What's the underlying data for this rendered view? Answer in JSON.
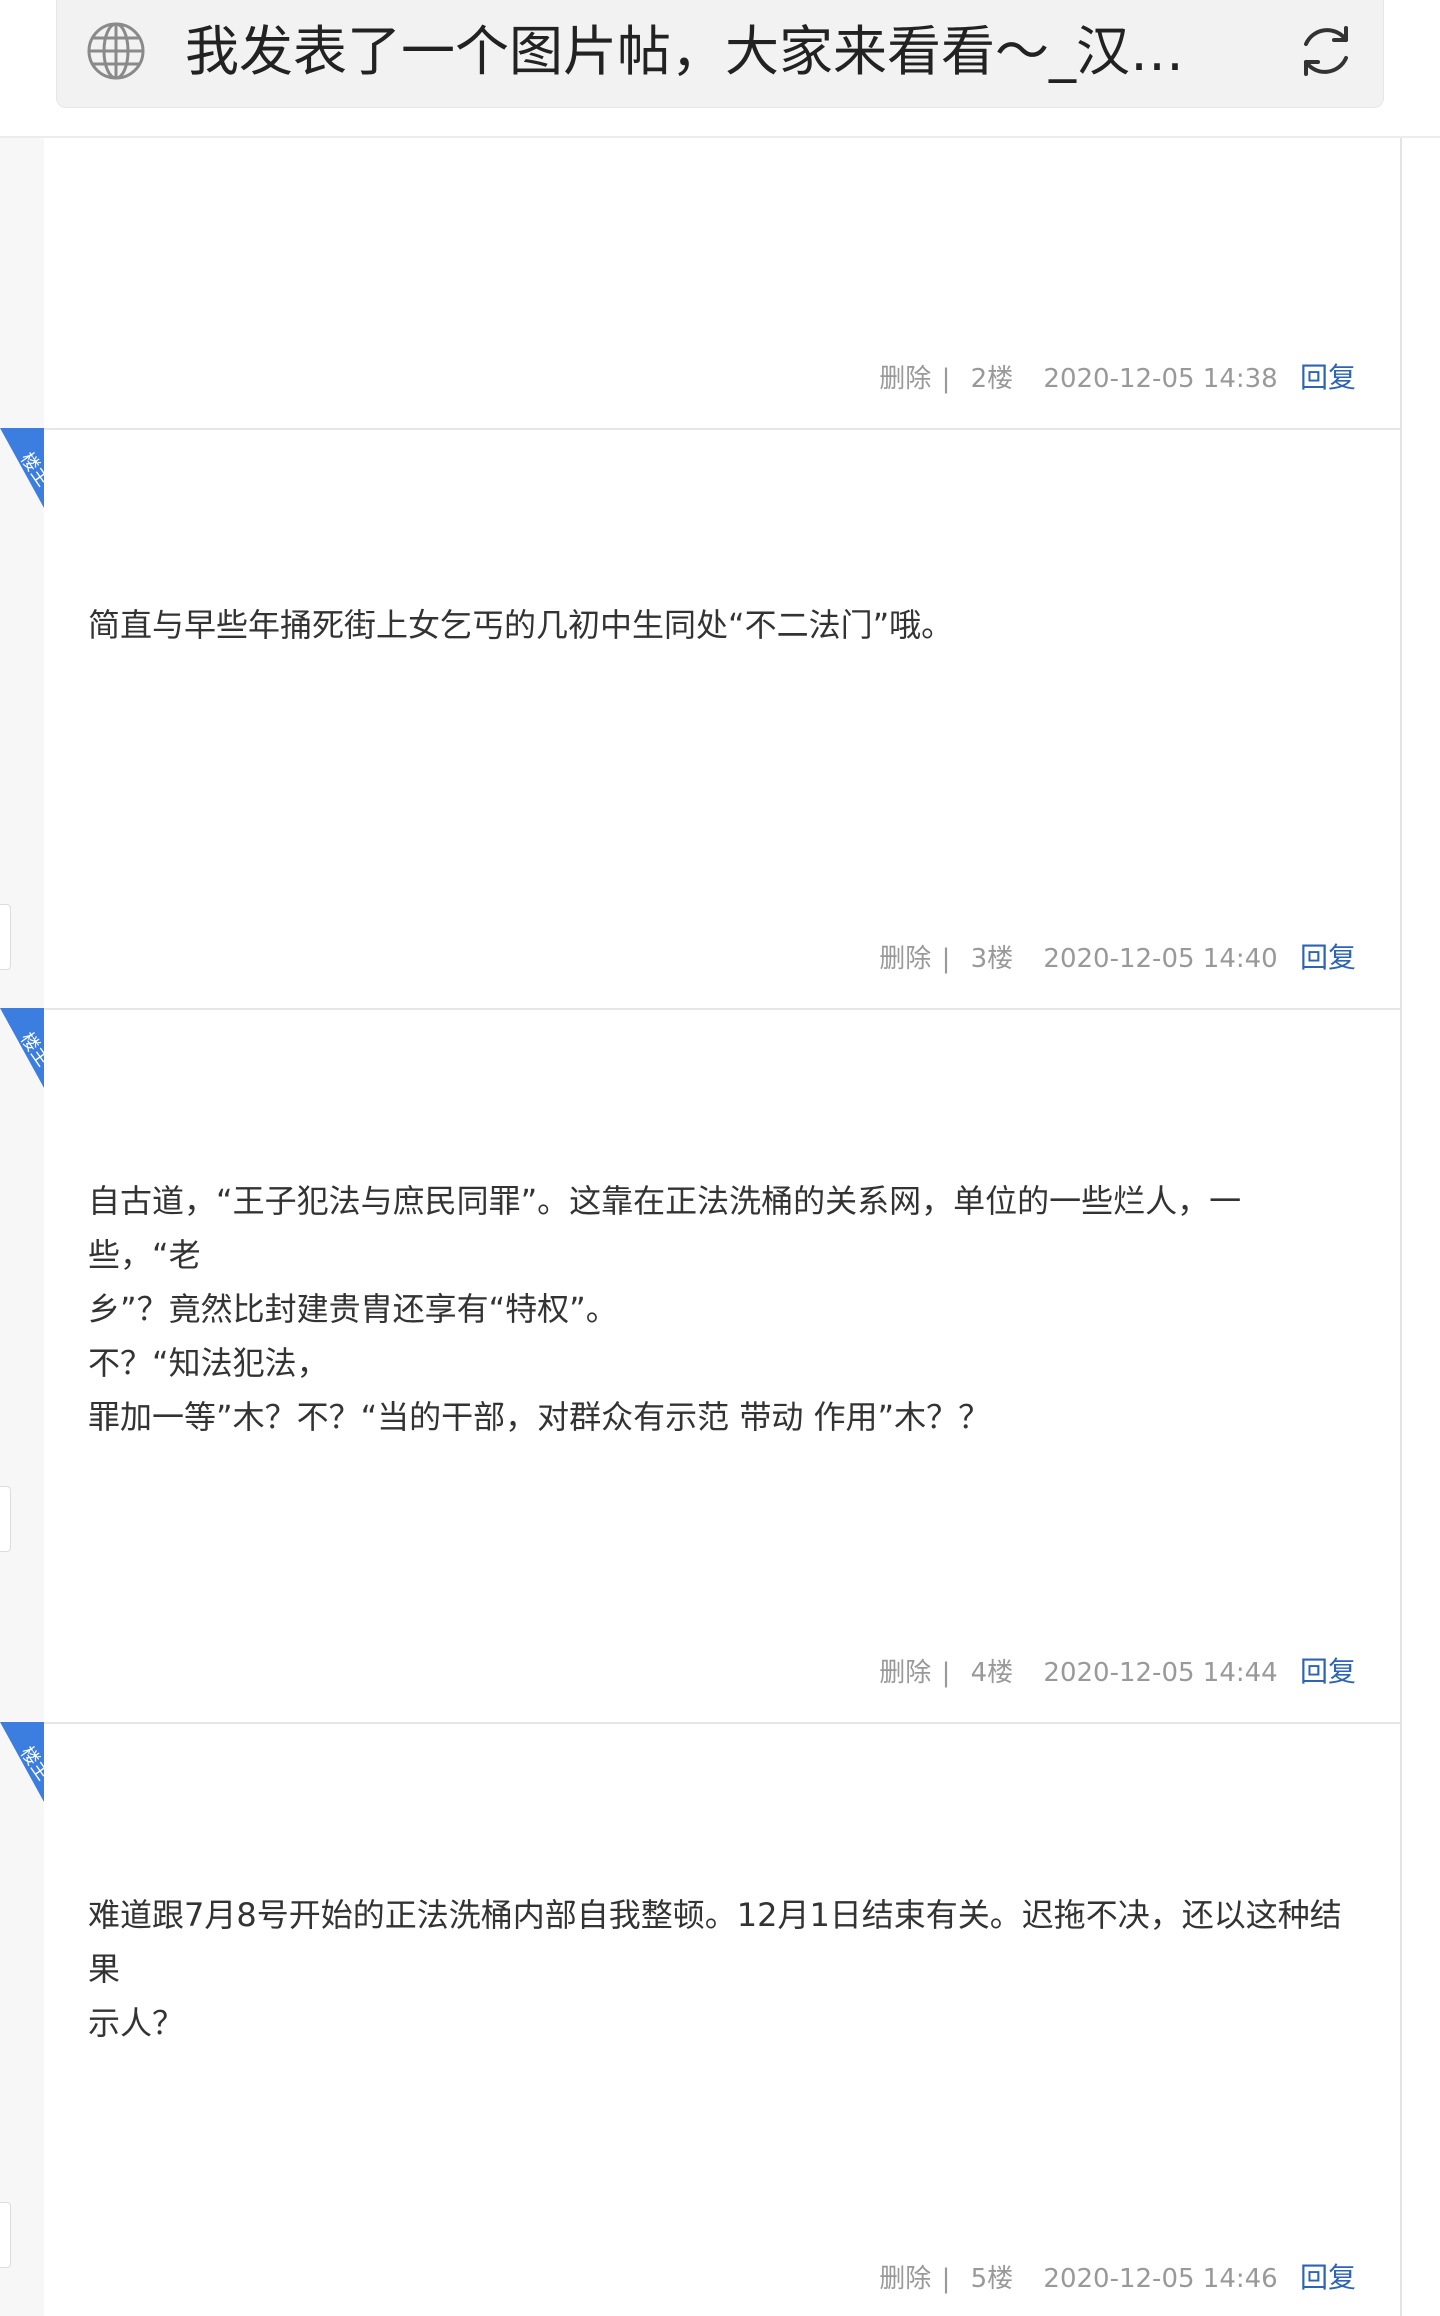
{
  "address_bar": {
    "title": "我发表了一个图片帖，大家来看看～_汉…",
    "globe_icon": "globe-icon",
    "reload_icon": "reload-icon"
  },
  "colors": {
    "link": "#2d64b3",
    "meta": "#999999",
    "text": "#333333",
    "badge": "#3c7de0"
  },
  "floors": [
    {
      "floor": "2楼",
      "time": "2020-12-05 14:38",
      "delete_label": "删除",
      "separator": "|",
      "reply_label": "回复",
      "lines": []
    },
    {
      "badge": "楼主",
      "floor": "3楼",
      "time": "2020-12-05 14:40",
      "delete_label": "删除",
      "separator": "|",
      "reply_label": "回复",
      "lines": [
        "简直与早些年捅死街上女乞丐的几初中生同处“不二法门”哦。"
      ]
    },
    {
      "badge": "楼主",
      "floor": "4楼",
      "time": "2020-12-05 14:44",
      "delete_label": "删除",
      "separator": "|",
      "reply_label": "回复",
      "lines": [
        "自古道，“王子犯法与庶民同罪”。这靠在正法洗桶的关系网，单位的一些烂人，一些，“老",
        "乡”？竟然比封建贵胄还享有“特权”。",
        "不？“知法犯法，",
        "罪加一等”木？不？“当的干部，对群众有示范 带动 作用”木？？"
      ]
    },
    {
      "badge": "楼主",
      "floor": "5楼",
      "time": "2020-12-05 14:46",
      "delete_label": "删除",
      "separator": "|",
      "reply_label": "回复",
      "lines": [
        "难道跟7月8号开始的正法洗桶内部自我整顿。12月1日结束有关。迟拖不决，还以这种结果",
        "示人？"
      ]
    }
  ]
}
